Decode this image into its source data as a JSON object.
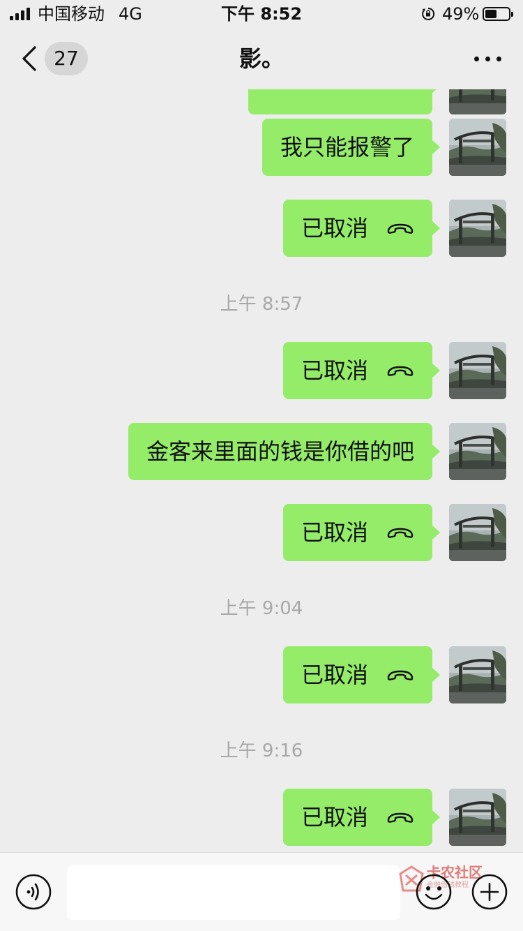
{
  "status_bar": {
    "carrier": "中国移动",
    "network": "4G",
    "time": "下午 8:52",
    "battery_percent": "49%",
    "battery_level": 0.49,
    "icons": [
      "signal-bars-icon",
      "rotation-lock-icon",
      "battery-icon"
    ]
  },
  "nav": {
    "back_icon": "chevron-left-icon",
    "unread_count": "27",
    "title": "影。",
    "more_icon": "ellipsis-icon"
  },
  "messages": [
    {
      "type": "text",
      "sender": "self",
      "text": ""
    },
    {
      "type": "text",
      "sender": "self",
      "text": "我只能报警了"
    },
    {
      "type": "call",
      "sender": "self",
      "text": "已取消",
      "icon": "hangup-phone-icon"
    },
    {
      "type": "time",
      "text": "上午 8:57"
    },
    {
      "type": "call",
      "sender": "self",
      "text": "已取消",
      "icon": "hangup-phone-icon"
    },
    {
      "type": "text",
      "sender": "self",
      "text": "金客来里面的钱是你借的吧"
    },
    {
      "type": "call",
      "sender": "self",
      "text": "已取消",
      "icon": "hangup-phone-icon"
    },
    {
      "type": "time",
      "text": "上午 9:04"
    },
    {
      "type": "call",
      "sender": "self",
      "text": "已取消",
      "icon": "hangup-phone-icon"
    },
    {
      "type": "time",
      "text": "上午 9:16"
    },
    {
      "type": "call",
      "sender": "self",
      "text": "已取消",
      "icon": "hangup-phone-icon"
    }
  ],
  "input_bar": {
    "voice_icon": "voice-input-icon",
    "input_value": "",
    "emoji_icon": "emoji-icon",
    "plus_icon": "plus-circle-icon"
  },
  "watermark": {
    "title": "卡农社区",
    "subtitle": "金融借钱教程"
  },
  "colors": {
    "background": "#ededed",
    "bubble_self": "#95ec69",
    "timestamp_text": "#a8a8a8",
    "input_bar": "#f7f7f7"
  }
}
